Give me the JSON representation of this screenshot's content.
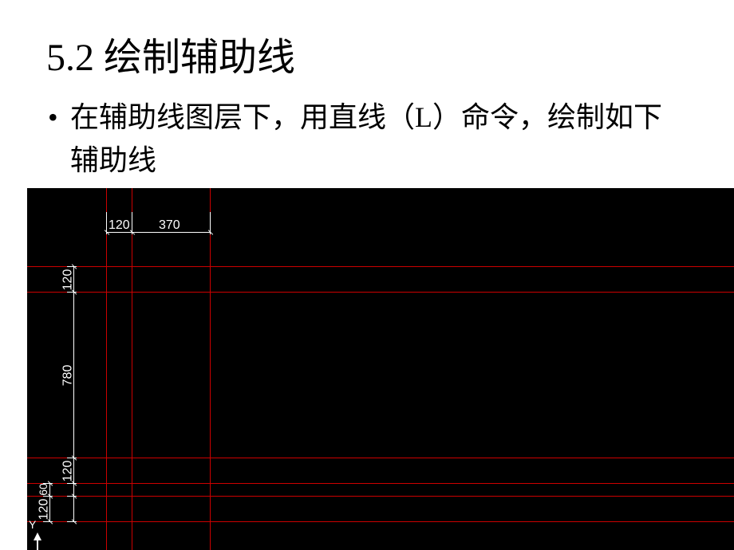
{
  "heading": "5.2 绘制辅助线",
  "bullet": "在辅助线图层下，用直线（L）命令，绘制如下辅助线",
  "dims": {
    "top_a": "120",
    "top_b": "370",
    "left_a": "120",
    "left_b": "780",
    "left_c": "120",
    "left_d": "60",
    "left_e": "120"
  },
  "ucs": {
    "y": "Y"
  }
}
